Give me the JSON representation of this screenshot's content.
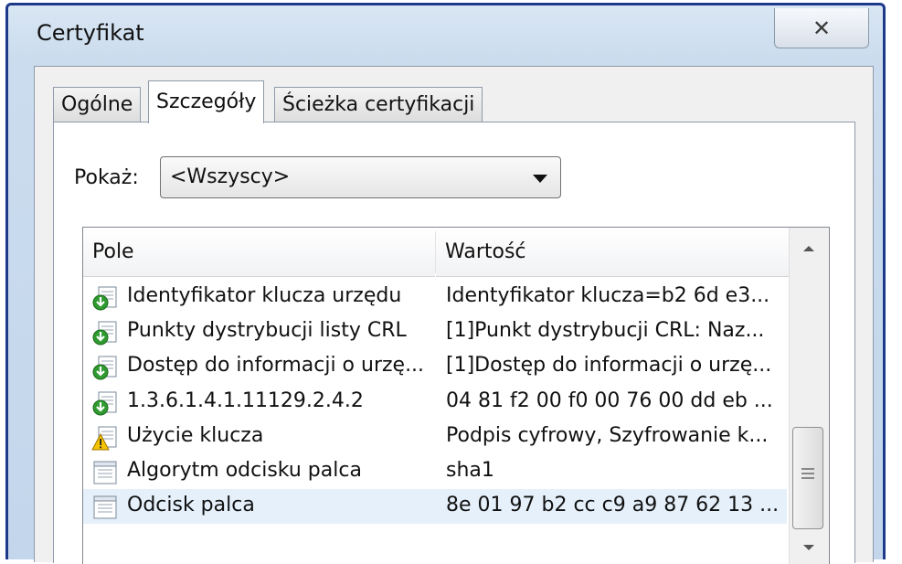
{
  "window": {
    "title": "Certyfikat",
    "close_glyph": "✕"
  },
  "tabs": [
    {
      "label": "Ogólne",
      "active": false
    },
    {
      "label": "Szczegóły",
      "active": true
    },
    {
      "label": "Ścieżka certyfikacji",
      "active": false
    }
  ],
  "show": {
    "label": "Pokaż:",
    "selected": "<Wszyscy>"
  },
  "list": {
    "columns": {
      "field": "Pole",
      "value": "Wartość"
    },
    "rows": [
      {
        "field": "Identyfikator klucza urzędu",
        "value": "Identyfikator klucza=b2 6d e3...",
        "icon": "extension-icon"
      },
      {
        "field": "Punkty dystrybucji listy CRL",
        "value": "[1]Punkt dystrybucji CRL: Naz...",
        "icon": "extension-icon"
      },
      {
        "field": "Dostęp do informacji o urzę...",
        "value": "[1]Dostęp do informacji o urzę...",
        "icon": "extension-icon"
      },
      {
        "field": "1.3.6.1.4.1.11129.2.4.2",
        "value": "04 81 f2 00 f0 00 76 00 dd eb ...",
        "icon": "extension-icon"
      },
      {
        "field": "Użycie klucza",
        "value": "Podpis cyfrowy, Szyfrowanie k...",
        "icon": "critical-extension-icon"
      },
      {
        "field": "Algorytm odcisku palca",
        "value": "sha1",
        "icon": "property-icon"
      },
      {
        "field": "Odcisk palca",
        "value": "8e 01 97 b2 cc c9 a9 87 62 13 ...",
        "icon": "property-icon",
        "selected": true
      }
    ]
  },
  "colors": {
    "frame_border": "#1d3a8a",
    "selected_row": "#e5f0fb",
    "extension_green": "#2f9a2f",
    "warning_yellow": "#f5c400"
  }
}
